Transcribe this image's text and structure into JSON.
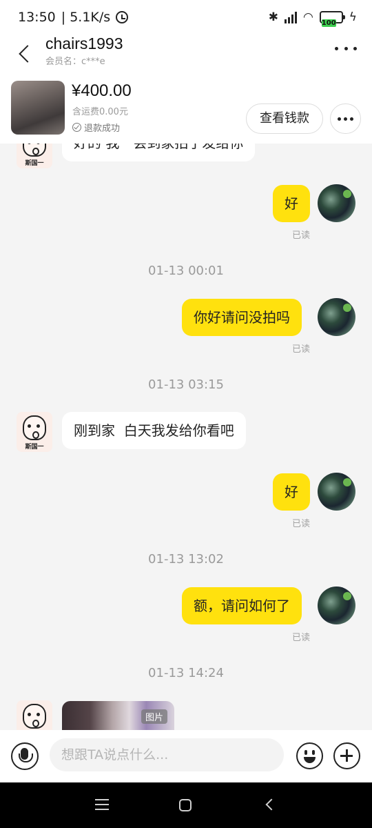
{
  "status_bar": {
    "time": "13:50",
    "speed": "| 5.1K/s",
    "battery": "100"
  },
  "header": {
    "title": "chairs1993",
    "member": "会员名：c***e"
  },
  "product": {
    "price": "¥400.00",
    "shipping": "含运费0.00元",
    "status": "退款成功",
    "view_button": "查看钱款"
  },
  "chat": {
    "top_partial_text": "好的 我一会到家拍了发给你",
    "messages": [
      {
        "from": "me",
        "text": "好",
        "read": "已读"
      },
      {
        "time": "01-13 00:01"
      },
      {
        "from": "me",
        "text": "你好请问没拍吗",
        "read": "已读"
      },
      {
        "time": "01-13 03:15"
      },
      {
        "from": "them",
        "text": "刚到家  白天我发给你看吧"
      },
      {
        "from": "me",
        "text": "好",
        "read": "已读"
      },
      {
        "time": "01-13 13:02"
      },
      {
        "from": "me",
        "text": "额，请问如何了",
        "read": "已读"
      },
      {
        "time": "01-13 14:24"
      },
      {
        "from": "them",
        "image": true,
        "image_tag": "图片"
      }
    ],
    "avatar_tag": "斯国一"
  },
  "input": {
    "placeholder": "想跟TA说点什么..."
  }
}
